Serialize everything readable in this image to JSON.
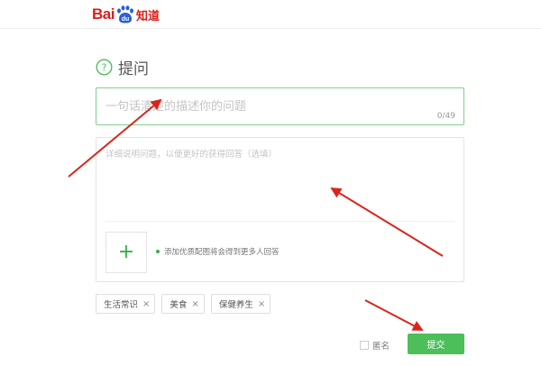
{
  "header": {
    "logo_bai": "Bai",
    "logo_du": "du",
    "logo_zhidao": "知道"
  },
  "ask": {
    "title": "提问",
    "title_placeholder": "一句话清楚的描述你的问题",
    "char_count": "0/49",
    "description_placeholder": "详细说明问题，以便更好的获得回答（选填）",
    "image_hint": "添加优质配图将会得到更多人回答",
    "add_image_icon": "plus-icon"
  },
  "tags": [
    {
      "label": "生活常识"
    },
    {
      "label": "美食"
    },
    {
      "label": "保健养生"
    }
  ],
  "footer": {
    "anonymous_label": "匿名",
    "submit_label": "提交"
  },
  "colors": {
    "brand_red": "#d9201c",
    "brand_blue": "#2b5fd6",
    "accent_green": "#4cbe5a",
    "annotation_red": "#d9251d"
  }
}
